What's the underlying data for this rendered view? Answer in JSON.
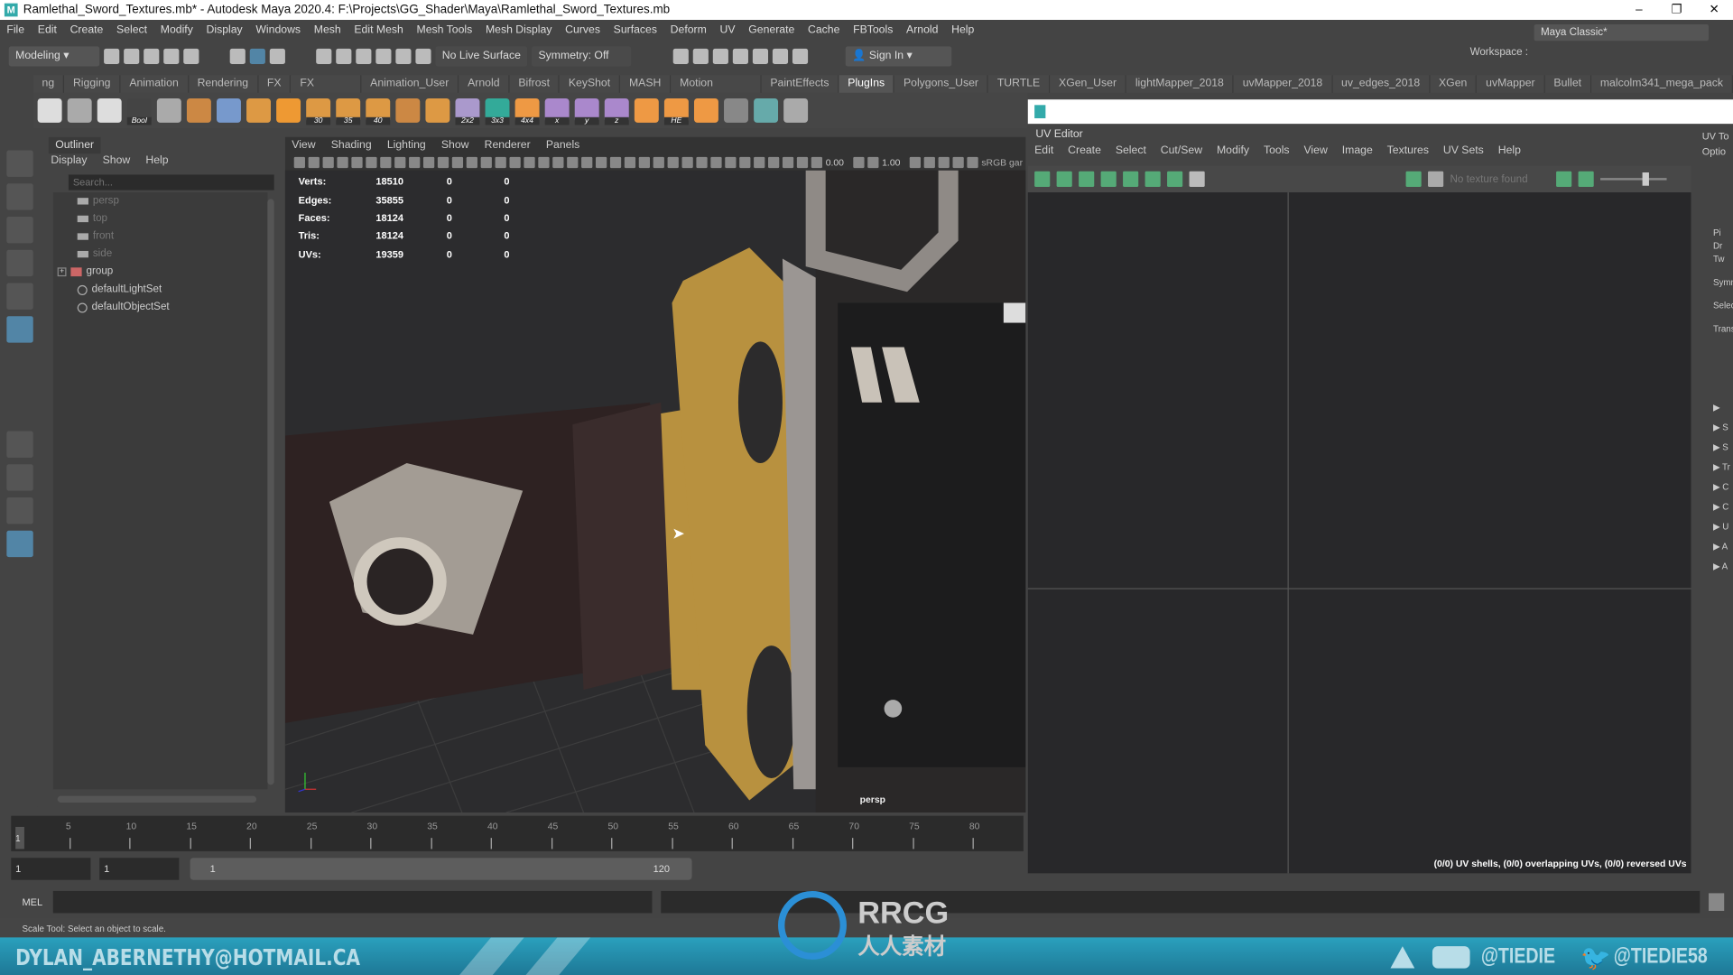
{
  "window": {
    "title": "Ramlethal_Sword_Textures.mb* - Autodesk Maya 2020.4: F:\\Projects\\GG_Shader\\Maya\\Ramlethal_Sword_Textures.mb",
    "logo": "M"
  },
  "menu": [
    "File",
    "Edit",
    "Create",
    "Select",
    "Modify",
    "Display",
    "Windows",
    "Mesh",
    "Edit Mesh",
    "Mesh Tools",
    "Mesh Display",
    "Curves",
    "Surfaces",
    "Deform",
    "UV",
    "Generate",
    "Cache",
    "FBTools",
    "Arnold",
    "Help"
  ],
  "status_line": {
    "mode": "Modeling",
    "live_surface": "No Live Surface",
    "symmetry": "Symmetry: Off",
    "sign_in": "Sign In",
    "workspace_label": "Workspace :",
    "workspace": "Maya Classic*"
  },
  "shelf_tabs": [
    "ng",
    "Rigging",
    "Animation",
    "Rendering",
    "FX",
    "FX Caching",
    "Animation_User",
    "Arnold",
    "Bifrost",
    "KeyShot",
    "MASH",
    "Motion Graphics",
    "PaintEffects",
    "PlugIns",
    "Polygons_User",
    "TURTLE",
    "XGen_User",
    "lightMapper_2018",
    "uvMapper_2018",
    "uv_edges_2018",
    "XGen",
    "uvMapper",
    "Bullet",
    "malcolm341_mega_pack"
  ],
  "shelf_active": "PlugIns",
  "shelf_labels": [
    "Bool",
    "30",
    "35",
    "40",
    "2x2",
    "3x3",
    "4x4",
    "x",
    "y",
    "z",
    "HE"
  ],
  "outliner": {
    "tab": "Outliner",
    "menu": [
      "Display",
      "Show",
      "Help"
    ],
    "search_placeholder": "Search...",
    "items": [
      {
        "label": "persp",
        "type": "camera"
      },
      {
        "label": "top",
        "type": "camera"
      },
      {
        "label": "front",
        "type": "camera"
      },
      {
        "label": "side",
        "type": "camera"
      },
      {
        "label": "group",
        "type": "group"
      },
      {
        "label": "defaultLightSet",
        "type": "set"
      },
      {
        "label": "defaultObjectSet",
        "type": "set"
      }
    ]
  },
  "viewport": {
    "menu": [
      "View",
      "Shading",
      "Lighting",
      "Show",
      "Renderer",
      "Panels"
    ],
    "exposure": "0.00",
    "gamma": "1.00",
    "color_space": "sRGB gar",
    "camera": "persp",
    "stats": [
      [
        "Verts:",
        "18510",
        "0",
        "0"
      ],
      [
        "Edges:",
        "35855",
        "0",
        "0"
      ],
      [
        "Faces:",
        "18124",
        "0",
        "0"
      ],
      [
        "Tris:",
        "18124",
        "0",
        "0"
      ],
      [
        "UVs:",
        "19359",
        "0",
        "0"
      ]
    ]
  },
  "uv_editor": {
    "title": "UV Editor",
    "menu": [
      "Edit",
      "Create",
      "Select",
      "Cut/Sew",
      "Modify",
      "Tools",
      "View",
      "Image",
      "Textures",
      "UV Sets",
      "Help"
    ],
    "texture": "No texture found",
    "info": "(0/0) UV shells, (0/0) overlapping UVs, (0/0) reversed UVs"
  },
  "uv_toolkit": {
    "title": "UV To",
    "options": "Optio",
    "items": [
      "Pi",
      "Dr",
      "Tw",
      "Symm",
      "Selec",
      "Trans"
    ],
    "sections": [
      "",
      "S",
      "S",
      "Tr",
      "C",
      "C",
      "U",
      "A",
      "A"
    ],
    "bottom": "U"
  },
  "timeline": {
    "ticks": [
      5,
      10,
      15,
      20,
      25,
      30,
      35,
      40,
      45,
      50,
      55,
      60,
      65,
      70,
      75,
      80
    ],
    "current": "1"
  },
  "range": {
    "start": "1",
    "playback_start": "1",
    "slider_start": "1",
    "slider_end": "120"
  },
  "command_line": {
    "lang": "MEL"
  },
  "help_line": "Scale Tool: Select an object to scale.",
  "banner": {
    "email": "DYLAN_ABERNETHY@HOTMAIL.CA",
    "youtube": "@TIEDIE",
    "twitter": "@TIEDIE58"
  },
  "watermark": {
    "text": "RRCG",
    "sub": "人人素材"
  },
  "colors": {
    "accent": "#5285a6",
    "gold": "#b8913f",
    "banner": "#2aa0bd"
  }
}
